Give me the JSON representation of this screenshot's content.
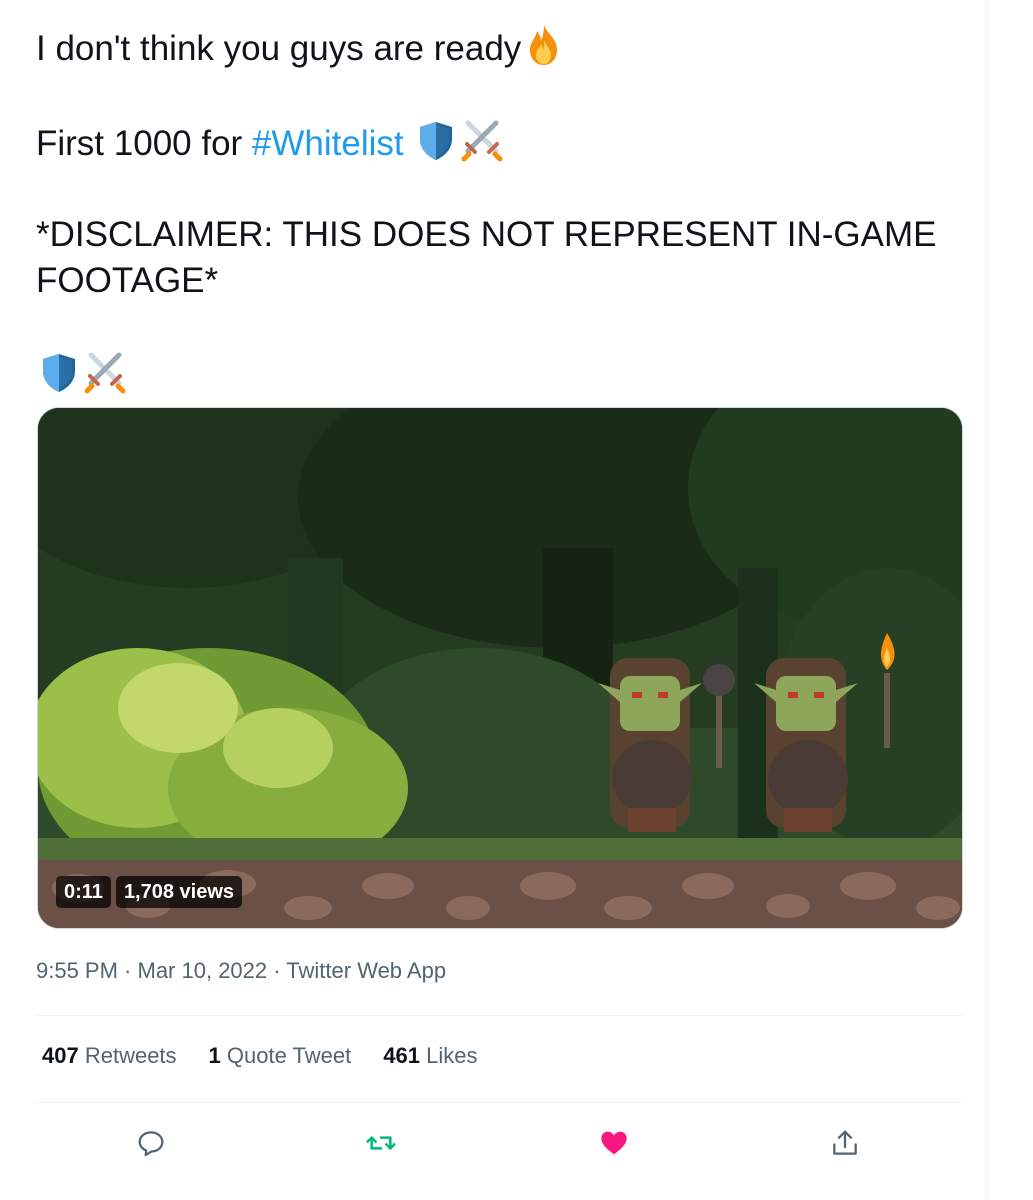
{
  "tweet": {
    "line1": "I don't think you guys are ready",
    "line2_prefix": "First 1000 for ",
    "hashtag": "#Whitelist",
    "line3a": "*DISCLAIMER: THIS DOES NOT REPRESENT IN-GAME",
    "line3b": "FOOTAGE*",
    "emojis": [
      "fire-emoji",
      "shield-emoji",
      "crossed-swords-emoji"
    ]
  },
  "video": {
    "duration": "0:11",
    "views": "1,708 views"
  },
  "meta": {
    "time": "9:55 PM",
    "sep1": " · ",
    "date": "Mar 10, 2022",
    "sep2": " · ",
    "source": "Twitter Web App"
  },
  "stats": {
    "retweets_count": "407",
    "retweets_label": " Retweets",
    "quotes_count": "1",
    "quotes_label": " Quote Tweet",
    "likes_count": "461",
    "likes_label": " Likes"
  },
  "actions": [
    "reply-icon",
    "retweet-icon",
    "like-icon",
    "share-icon"
  ],
  "colors": {
    "link": "#1d9bf0",
    "retweet_green": "#00ba7c",
    "like_pink": "#f91880",
    "muted": "#536471"
  }
}
